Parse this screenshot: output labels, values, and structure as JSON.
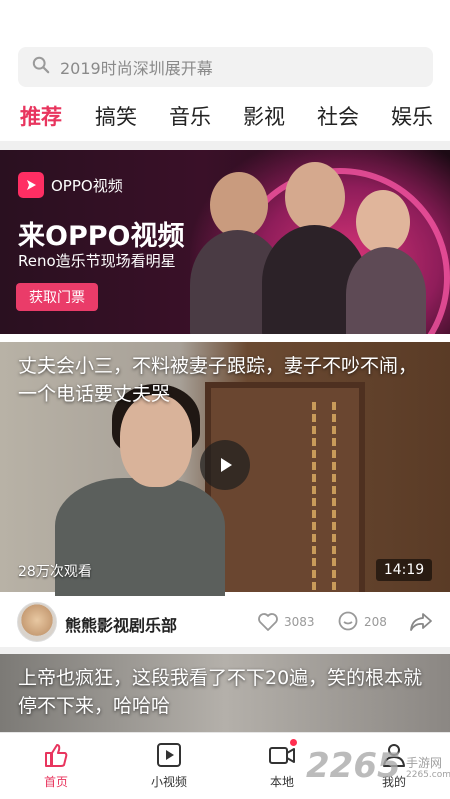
{
  "search": {
    "placeholder": "2019时尚深圳展开幕",
    "icon": "search-icon"
  },
  "tabs": [
    {
      "label": "推荐",
      "active": true
    },
    {
      "label": "搞笑"
    },
    {
      "label": "音乐"
    },
    {
      "label": "影视"
    },
    {
      "label": "社会"
    },
    {
      "label": "娱乐"
    }
  ],
  "banner": {
    "brand": "OPPO视频",
    "title": "来OPPO视频",
    "subtitle": "Reno造乐节现场看明星",
    "button": "获取门票",
    "accent": "#ea3c69"
  },
  "feed": [
    {
      "title": "丈夫会小三，不料被妻子跟踪，妻子不吵不闹，一个电话要丈夫哭",
      "views": "28万次观看",
      "duration": "14:19",
      "author": "熊熊影视剧乐部",
      "likes": "3083",
      "comments": "208"
    },
    {
      "title": "上帝也疯狂，这段我看了不下20遍，笑的根本就停不下来，哈哈哈"
    }
  ],
  "bottom_nav": [
    {
      "label": "首页",
      "icon": "home-thumb-icon",
      "active": true
    },
    {
      "label": "小视频",
      "icon": "play-square-icon"
    },
    {
      "label": "本地",
      "icon": "camera-icon"
    },
    {
      "label": "我的",
      "icon": "user-icon"
    }
  ],
  "watermark": {
    "number": "2265",
    "text": "手游网",
    "url": "2265.com"
  }
}
